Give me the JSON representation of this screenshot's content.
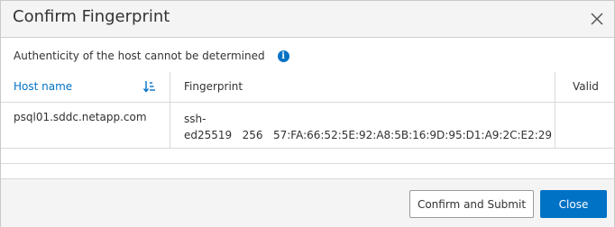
{
  "dialog": {
    "title": "Confirm Fingerprint",
    "subtitle": "Authenticity of the host cannot be determined",
    "info_icon": "i"
  },
  "table": {
    "columns": {
      "host": "Host name",
      "fingerprint": "Fingerprint",
      "valid": "Valid"
    },
    "rows": [
      {
        "host": "psql01.sddc.netapp.com",
        "fingerprint_line1": "ssh-",
        "fingerprint_line2": "ed25519   256   57:FA:66:52:5E:92:A8:5B:16:9D:95:D1:A9:2C:E2:29",
        "valid": ""
      }
    ]
  },
  "footer": {
    "confirm_label": "Confirm and Submit",
    "close_label": "Close"
  },
  "colors": {
    "accent": "#0072c6",
    "header_bg": "#f4f4f4"
  }
}
